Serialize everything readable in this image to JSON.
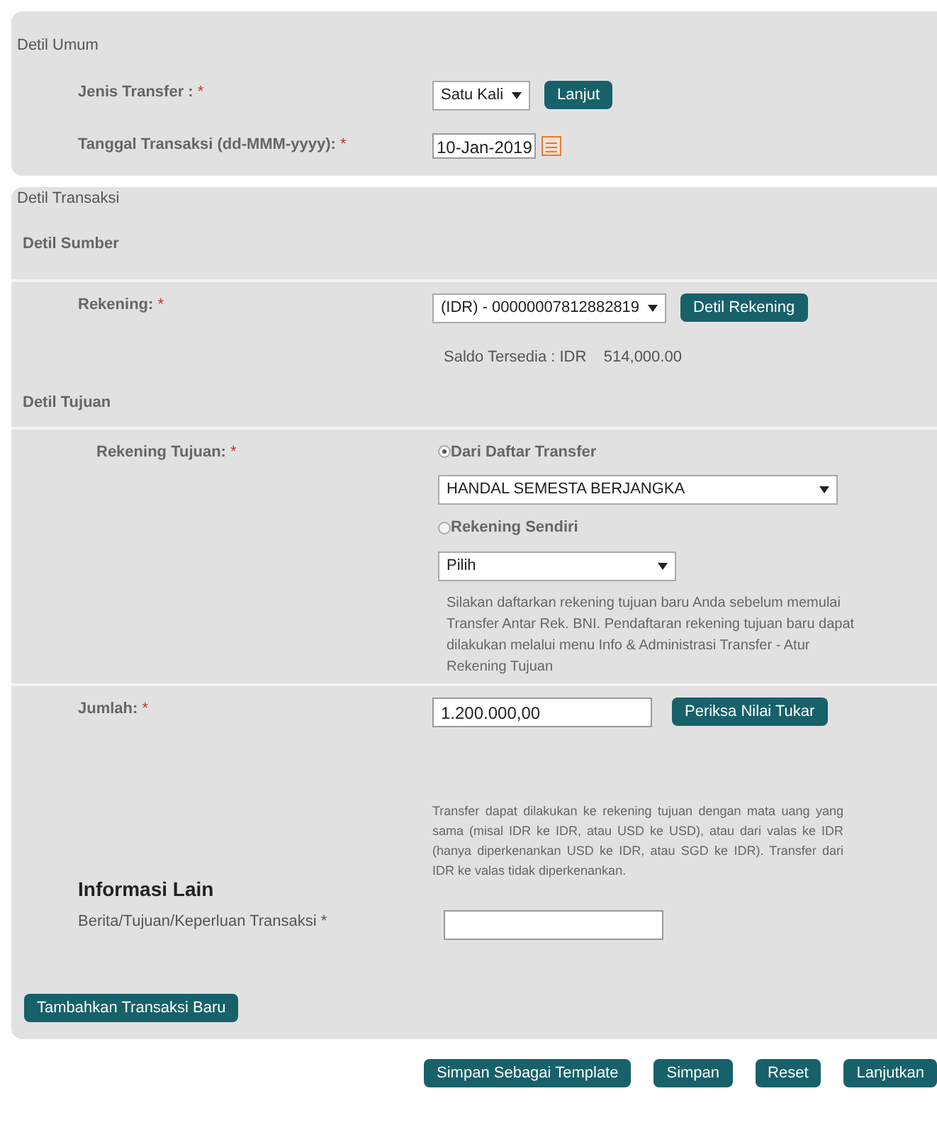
{
  "detil_umum": {
    "title": "Detil Umum",
    "jenis_transfer": {
      "label": "Jenis Transfer :",
      "required_mark": "*",
      "value": "Satu Kali",
      "button": "Lanjut"
    },
    "tanggal": {
      "label": "Tanggal Transaksi (dd-MMM-yyyy):",
      "required_mark": "*",
      "value": "10-Jan-2019"
    }
  },
  "detil_transaksi": {
    "title": "Detil Transaksi",
    "detil_sumber": {
      "title": "Detil Sumber",
      "rekening": {
        "label": "Rekening:",
        "required_mark": "*",
        "value": "(IDR) - 00000007812882819",
        "button": "Detil Rekening"
      },
      "saldo": "Saldo Tersedia : IDR    514,000.00"
    },
    "detil_tujuan": {
      "title": "Detil Tujuan",
      "label": "Rekening Tujuan:",
      "required_mark": "*",
      "options": [
        {
          "label": "Dari Daftar Transfer",
          "selected": true,
          "value": "HANDAL SEMESTA BERJANGKA"
        },
        {
          "label": "Rekening Sendiri",
          "selected": false,
          "value": "Pilih"
        }
      ],
      "note": "Silakan daftarkan rekening tujuan baru Anda sebelum memulai Transfer Antar Rek. BNI. Pendaftaran rekening tujuan baru dapat dilakukan melalui menu Info & Administrasi Transfer - Atur Rekening Tujuan"
    },
    "jumlah": {
      "label": "Jumlah:",
      "required_mark": "*",
      "value": "1.200.000,00",
      "button": "Periksa Nilai Tukar",
      "note": "Transfer dapat dilakukan ke rekening tujuan dengan mata uang yang sama (misal IDR ke IDR, atau USD ke USD), atau dari valas ke IDR (hanya diperkenankan USD ke IDR, atau SGD ke IDR). Transfer dari IDR ke valas tidak diperkenankan."
    },
    "informasi_lain": {
      "title": "Informasi Lain",
      "label": "Berita/Tujuan/Keperluan Transaksi *"
    },
    "add_button": "Tambahkan Transaksi Baru"
  },
  "buttons": [
    "Simpan Sebagai Template",
    "Simpan",
    "Reset",
    "Lanjutkan"
  ]
}
